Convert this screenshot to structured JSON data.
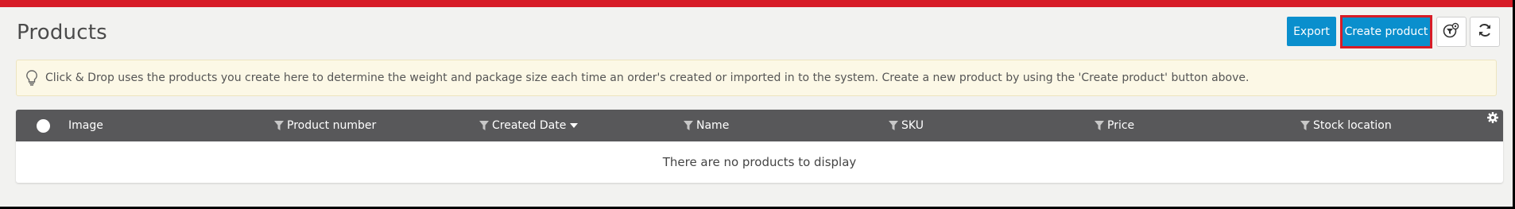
{
  "page": {
    "title": "Products",
    "accent_color": "#d71c27",
    "button_color": "#0a8fcd"
  },
  "toolbar": {
    "export_label": "Export",
    "create_label": "Create product",
    "filter_settings_icon": "filter-settings-icon",
    "refresh_icon": "refresh-icon"
  },
  "info": {
    "icon": "lightbulb-icon",
    "text": "Click & Drop uses the products you create here to determine the weight and package size each time an order's created or imported in to the system. Create a new product by using the 'Create product' button above."
  },
  "table": {
    "columns": [
      {
        "label": "Image",
        "filter": false
      },
      {
        "label": "Product number",
        "filter": true
      },
      {
        "label": "Created Date",
        "filter": true,
        "sorted": "descending"
      },
      {
        "label": "Name",
        "filter": true
      },
      {
        "label": "SKU",
        "filter": true
      },
      {
        "label": "Price",
        "filter": true
      },
      {
        "label": "Stock location",
        "filter": true
      }
    ],
    "empty_message": "There are no products to display",
    "settings_icon": "gear-icon"
  }
}
